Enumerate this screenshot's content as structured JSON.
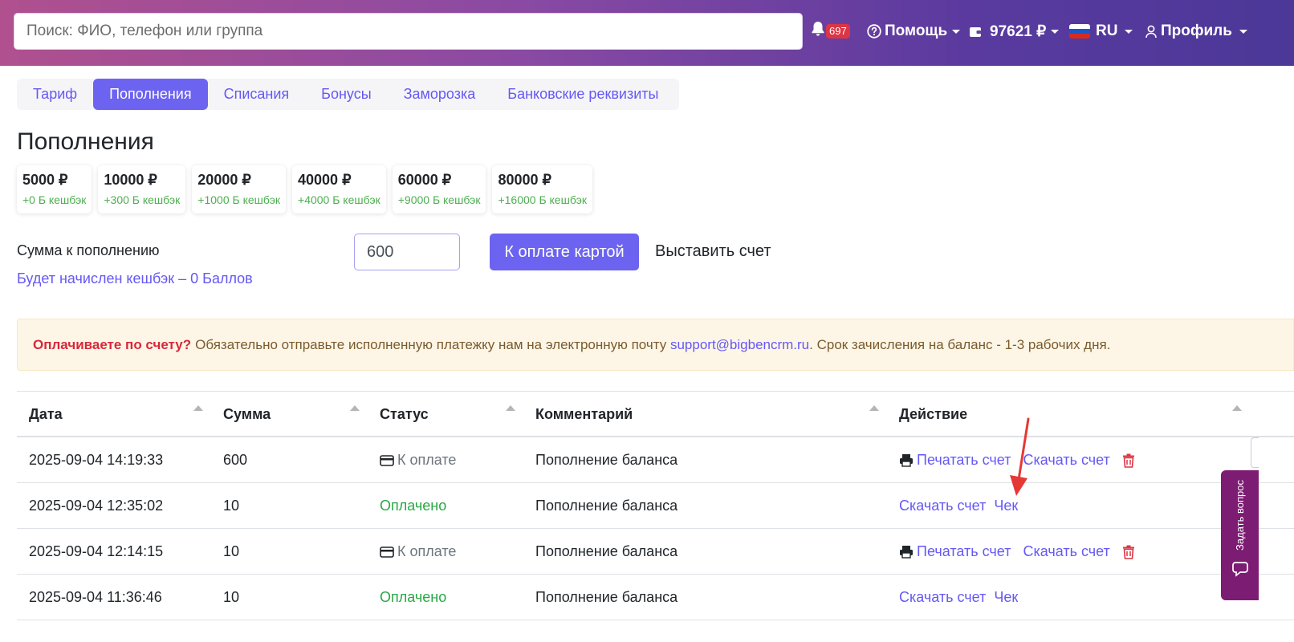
{
  "header": {
    "search_placeholder": "Поиск: ФИО, телефон или группа",
    "notifications_count": "697",
    "help_label": "Помощь",
    "balance": "97621 ₽",
    "language": "RU",
    "profile_label": "Профиль"
  },
  "tabs": [
    {
      "label": "Тариф",
      "active": false
    },
    {
      "label": "Пополнения",
      "active": true
    },
    {
      "label": "Списания",
      "active": false
    },
    {
      "label": "Бонусы",
      "active": false
    },
    {
      "label": "Заморозка",
      "active": false
    },
    {
      "label": "Банковские реквизиты",
      "active": false
    }
  ],
  "page_title": "Пополнения",
  "amount_cards": [
    {
      "amount": "5000 ₽",
      "cashback": "+0 Б кешбэк"
    },
    {
      "amount": "10000 ₽",
      "cashback": "+300 Б кешбэк"
    },
    {
      "amount": "20000 ₽",
      "cashback": "+1000 Б кешбэк"
    },
    {
      "amount": "40000 ₽",
      "cashback": "+4000 Б кешбэк"
    },
    {
      "amount": "60000 ₽",
      "cashback": "+9000 Б кешбэк"
    },
    {
      "amount": "80000 ₽",
      "cashback": "+16000 Б кешбэк"
    }
  ],
  "topup": {
    "label": "Сумма к пополнению",
    "cashback_note": "Будет начислен кешбэк – 0 Баллов",
    "value": "600",
    "pay_button": "К оплате картой",
    "invoice_button": "Выставить счет"
  },
  "alert": {
    "strong": "Оплачиваете по счету?",
    "text_before": "Обязательно отправьте исполненную платежку нам на электронную почту",
    "email": "support@bigbencrm.ru",
    "text_after": ". Срок зачисления на баланс - 1-3 рабочих дня."
  },
  "table": {
    "headers": {
      "date": "Дата",
      "sum": "Сумма",
      "status": "Статус",
      "comment": "Комментарий",
      "action": "Действие"
    },
    "rows": [
      {
        "date": "2025-09-04 14:19:33",
        "sum": "600",
        "status": "К оплате",
        "comment": "Пополнение баланса",
        "print": "Печатать счет",
        "download": "Скачать счет"
      },
      {
        "date": "2025-09-04 12:35:02",
        "sum": "10",
        "status": "Оплачено",
        "comment": "Пополнение баланса",
        "download": "Скачать счет",
        "receipt": "Чек"
      },
      {
        "date": "2025-09-04 12:14:15",
        "sum": "10",
        "status": "К оплате",
        "comment": "Пополнение баланса",
        "print": "Печатать счет",
        "download": "Скачать счет"
      },
      {
        "date": "2025-09-04 11:36:46",
        "sum": "10",
        "status": "Оплачено",
        "comment": "Пополнение баланса",
        "download": "Скачать счет",
        "receipt": "Чек"
      }
    ]
  },
  "ask_question": "Задать вопрос",
  "colors": {
    "accent": "#6c63f0",
    "paid": "#28a745",
    "danger": "#dc3545",
    "cashback": "#4caf50"
  },
  "icons": [
    "bell-icon",
    "question-circle-icon",
    "wallet-icon",
    "russia-flag-icon",
    "user-icon",
    "credit-card-icon",
    "printer-icon",
    "trash-icon",
    "chat-icon"
  ]
}
